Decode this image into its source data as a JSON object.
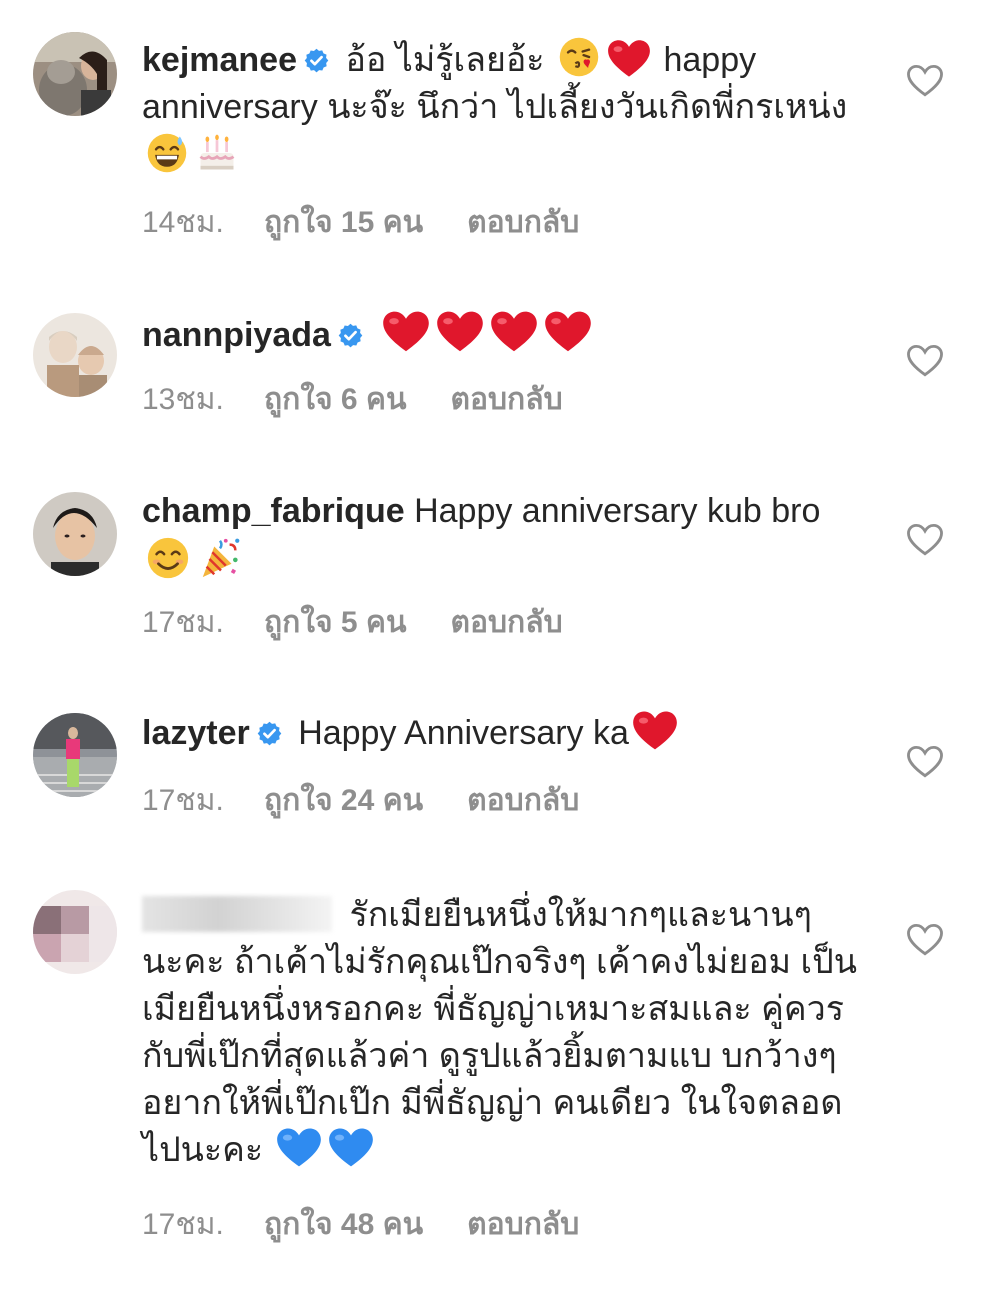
{
  "comments": [
    {
      "username": "kejmanee",
      "verified": true,
      "text_1": "อ้อ ไม่รู้เลยอ้ะ",
      "text_2": "happy anniversary นะจ๊ะ นึกว่า ไปเลี้ยงวันเกิดพี่กรเหน่ง",
      "emojis": [
        "kissing-face-emoji",
        "red-heart-emoji",
        "grinning-sweat-emoji",
        "birthday-cake-emoji"
      ],
      "time": "14ชม.",
      "likes": "ถูกใจ 15 คน",
      "reply": "ตอบกลับ"
    },
    {
      "username": "nannpiyada",
      "verified": true,
      "text_1": "",
      "emojis": [
        "red-heart-emoji",
        "red-heart-emoji",
        "red-heart-emoji",
        "red-heart-emoji"
      ],
      "time": "13ชม.",
      "likes": "ถูกใจ 6 คน",
      "reply": "ตอบกลับ"
    },
    {
      "username": "champ_fabrique",
      "verified": false,
      "text_1": "Happy anniversary kub bro",
      "emojis": [
        "smiling-face-emoji",
        "party-popper-emoji"
      ],
      "time": "17ชม.",
      "likes": "ถูกใจ 5 คน",
      "reply": "ตอบกลับ"
    },
    {
      "username": "lazyter",
      "verified": true,
      "text_1": "Happy Anniversary ka",
      "emojis": [
        "red-heart-emoji"
      ],
      "time": "17ชม.",
      "likes": "ถูกใจ 24 คน",
      "reply": "ตอบกลับ"
    },
    {
      "username": "",
      "verified": false,
      "text_1": "รักเมียยืนหนึ่งให้มากๆและนานๆ นะคะ ถ้าเค้าไม่รักคุณเป๊กจริงๆ เค้าคงไม่ยอม เป็นเมียยืนหนึ่งหรอกคะ พี่ธัญญ่าเหมาะสมและ คู่ควรกับพี่เป๊กที่สุดแล้วค่า ดูรูปแล้วยิ้มตามแบ บกว้างๆ อยากให้พี่เป๊กเป๊ก มีพี่ธัญญ่า คนเดียว ในใจตลอดไปนะคะ",
      "emojis": [
        "blue-heart-emoji",
        "blue-heart-emoji"
      ],
      "time": "17ชม.",
      "likes": "ถูกใจ 48 คน",
      "reply": "ตอบกลับ"
    }
  ],
  "colors": {
    "text": "#262626",
    "meta": "#8e8e8e",
    "verified": "#3897f0",
    "heart": "#e0245e",
    "blue_heart": "#2f8bf0"
  }
}
